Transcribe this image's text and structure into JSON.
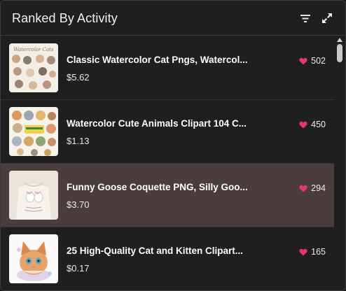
{
  "header": {
    "title": "Ranked By Activity",
    "filter_icon": "filter-icon",
    "expand_icon": "expand-icon"
  },
  "items": [
    {
      "name": "Classic Watercolor Cat Pngs, Watercol...",
      "price": "$5.62",
      "likes": "502",
      "thumb_text": "Watercolor Cats",
      "active": false
    },
    {
      "name": "Watercolor Cute Animals Clipart 104 C...",
      "price": "$1.13",
      "likes": "450",
      "active": false
    },
    {
      "name": "Funny Goose Coquette PNG, Silly Goo...",
      "price": "$3.70",
      "likes": "294",
      "active": true
    },
    {
      "name": "25 High-Quality Cat and Kitten Clipart...",
      "price": "$0.17",
      "likes": "165",
      "active": false
    }
  ],
  "colors": {
    "heart": "#e8356a",
    "active_row": "#4b3d3c",
    "background": "#1f1f1f"
  }
}
